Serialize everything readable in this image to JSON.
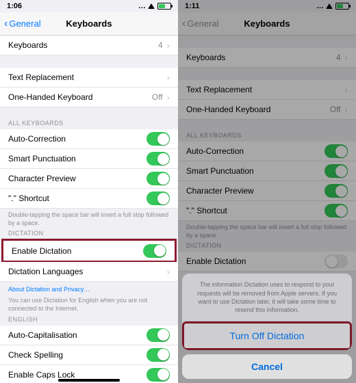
{
  "left": {
    "time": "1:06",
    "back": "General",
    "title": "Keyboards",
    "keyboards_label": "Keyboards",
    "keyboards_count": "4",
    "text_replacement": "Text Replacement",
    "one_handed": "One-Handed Keyboard",
    "one_handed_val": "Off",
    "section_all": "ALL KEYBOARDS",
    "auto_correction": "Auto-Correction",
    "smart_punct": "Smart Punctuation",
    "char_preview": "Character Preview",
    "shortcut": "\".\" Shortcut",
    "space_note": "Double-tapping the space bar will insert a full stop followed by a space.",
    "section_dict": "DICTATION",
    "enable_dict": "Enable Dictation",
    "dict_lang": "Dictation Languages",
    "about_link": "About Dictation and Privacy…",
    "dict_note": "You can use Dictation for English when you are not connected to the Internet.",
    "section_eng": "ENGLISH",
    "auto_cap": "Auto-Capitalisation",
    "check_sp": "Check Spelling",
    "caps_lock": "Enable Caps Lock"
  },
  "right": {
    "time": "1:11",
    "back": "General",
    "title": "Keyboards",
    "keyboards_label": "Keyboards",
    "keyboards_count": "4",
    "text_replacement": "Text Replacement",
    "one_handed": "One-Handed Keyboard",
    "one_handed_val": "Off",
    "section_all": "ALL KEYBOARDS",
    "auto_correction": "Auto-Correction",
    "smart_punct": "Smart Punctuation",
    "char_preview": "Character Preview",
    "shortcut": "\".\" Shortcut",
    "space_note": "Double-tapping the space bar will insert a full stop followed by a space.",
    "section_dict": "DICTATION",
    "enable_dict": "Enable Dictation",
    "sheet_msg": "The information Dictation uses to respond to your requests will be removed from Apple servers. If you want to use Dictation later, it will take some time to resend this information.",
    "turn_off": "Turn Off Dictation",
    "cancel": "Cancel"
  }
}
